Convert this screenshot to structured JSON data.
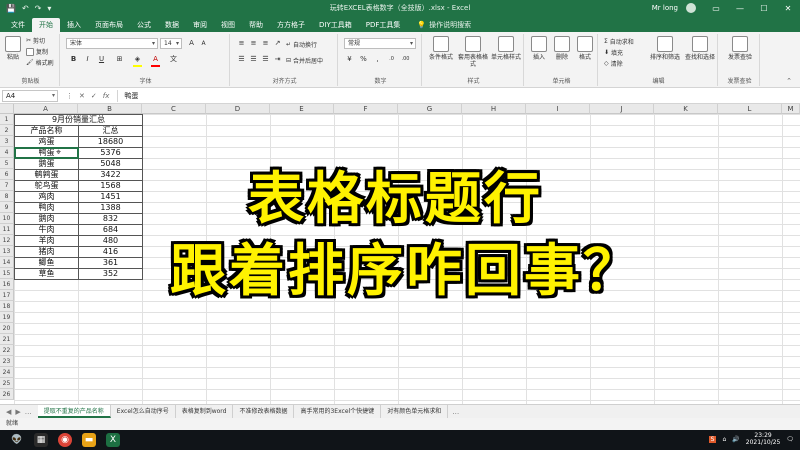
{
  "window": {
    "title": "玩转EXCEL表格数字（全技版）.xlsx - Excel",
    "user": "Mr long"
  },
  "tabs": [
    "文件",
    "开始",
    "插入",
    "页面布局",
    "公式",
    "数据",
    "审阅",
    "视图",
    "帮助",
    "方方格子",
    "DIY工具箱",
    "PDF工具集"
  ],
  "tell_me": "操作说明搜索",
  "ribbon": {
    "clipboard": {
      "paste": "粘贴",
      "cut": "剪切",
      "copy": "复制",
      "format_painter": "格式刷",
      "label": "剪贴板"
    },
    "font": {
      "name": "宋体",
      "size": "14",
      "bold": "B",
      "italic": "I",
      "underline": "U",
      "label": "字体"
    },
    "alignment": {
      "wrap": "自动换行",
      "merge": "合并后居中",
      "label": "对齐方式"
    },
    "number": {
      "format": "常规",
      "label": "数字"
    },
    "styles": {
      "conditional": "条件格式",
      "table": "套用表格格式",
      "cell_styles": "单元格样式",
      "label": "样式"
    },
    "cells": {
      "insert": "插入",
      "delete": "删除",
      "format": "格式",
      "label": "单元格"
    },
    "editing": {
      "autosum": "自动求和",
      "fill": "填充",
      "clear": "清除",
      "sort": "排序和筛选",
      "find": "查找和选择",
      "label": "编辑"
    },
    "invoice": {
      "check": "发票查验",
      "label": "发票查验"
    }
  },
  "formula_bar": {
    "name_box": "A4",
    "content": "鸭蛋",
    "cancel": "✕",
    "enter": "✓",
    "fx": "fx"
  },
  "columns": [
    "A",
    "B",
    "C",
    "D",
    "E",
    "F",
    "G",
    "H",
    "I",
    "J",
    "K",
    "L",
    "M",
    "N",
    "O"
  ],
  "rows": [
    "1",
    "2",
    "3",
    "4",
    "5",
    "6",
    "7",
    "8",
    "9",
    "10",
    "11",
    "12",
    "13",
    "14",
    "15",
    "16",
    "17",
    "18",
    "19",
    "20",
    "21",
    "22",
    "23",
    "24",
    "25",
    "26"
  ],
  "sheet": {
    "title": "9月份销量汇总",
    "header": {
      "product": "产品名称",
      "total": "汇总"
    },
    "rows": [
      {
        "name": "鸡蛋",
        "total": "18680"
      },
      {
        "name": "鸭蛋",
        "total": "5376"
      },
      {
        "name": "鹅蛋",
        "total": "5048"
      },
      {
        "name": "鹌鹑蛋",
        "total": "3422"
      },
      {
        "name": "鸵鸟蛋",
        "total": "1568"
      },
      {
        "name": "鸡肉",
        "total": "1451"
      },
      {
        "name": "鸭肉",
        "total": "1388"
      },
      {
        "name": "鹅肉",
        "total": "832"
      },
      {
        "name": "牛肉",
        "total": "684"
      },
      {
        "name": "羊肉",
        "total": "480"
      },
      {
        "name": "猪肉",
        "total": "416"
      },
      {
        "name": "鲫鱼",
        "total": "361"
      },
      {
        "name": "草鱼",
        "total": "352"
      }
    ]
  },
  "overlay": {
    "line1": "表格标题行",
    "line2": "跟着排序咋回事？",
    "color": "#fff200"
  },
  "sheet_tabs": [
    "提取不重复的产品名称",
    "Excel怎么自动序号",
    "表格复制到word",
    "不准修改表格数据",
    "高手常用的3Excel个快捷键",
    "对有颜色单元格求和"
  ],
  "status": "就绪",
  "taskbar": {
    "time": "23:29",
    "date": "2021/10/25"
  },
  "colors": {
    "excel_green": "#217346"
  }
}
